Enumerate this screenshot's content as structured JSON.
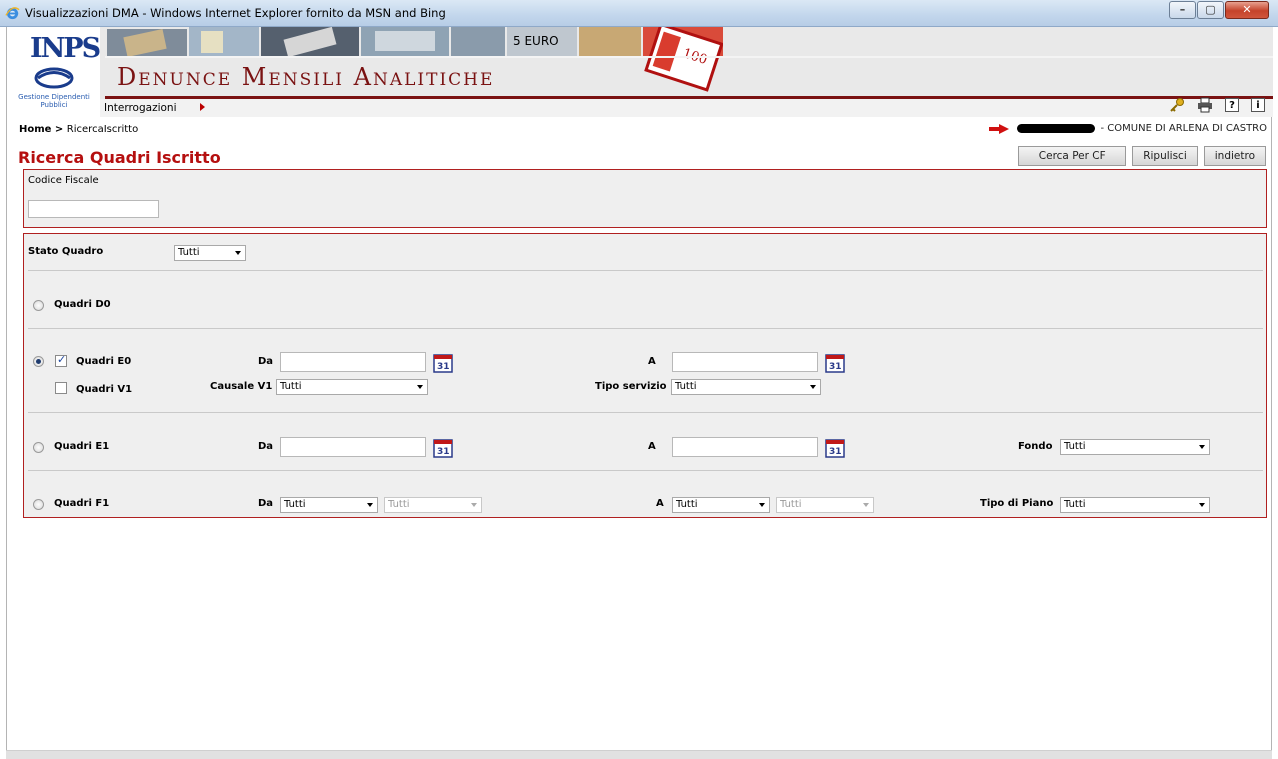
{
  "window": {
    "title": "Visualizzazioni DMA - Windows Internet Explorer fornito da MSN and Bing",
    "buttons": [
      "–",
      "▢",
      "✕"
    ]
  },
  "header": {
    "logo_text": "INPS",
    "logo_sub": "Gestione Dipendenti Pubblici",
    "banner_title": "Denunce Mensili Analitiche",
    "banner_photo_text_5euro": "5 EURO",
    "banner_photo_text_100": "100",
    "menu": {
      "label": "Interrogazioni"
    },
    "toolbar_icons": [
      "key-icon",
      "printer-icon",
      "help-icon",
      "info-icon"
    ],
    "help_label": "?",
    "info_label": "i"
  },
  "breadcrumb": {
    "home": "Home",
    "sep": " > ",
    "current": "RicercaIscritto"
  },
  "user": {
    "entity": "- COMUNE DI ARLENA DI CASTRO"
  },
  "page": {
    "title": "Ricerca Quadri Iscritto"
  },
  "actions": {
    "search_cf": "Cerca Per CF",
    "reset": "Ripulisci",
    "back": "indietro"
  },
  "search": {
    "codice_fiscale_label": "Codice Fiscale",
    "codice_fiscale_value": ""
  },
  "filters": {
    "stato_quadro_label": "Stato Quadro",
    "stato_quadro_value": "Tutti",
    "d0": {
      "label": "Quadri D0",
      "selected": false
    },
    "e0": {
      "label": "Quadri E0",
      "selected": true,
      "checked": true,
      "da_label": "Da",
      "a_label": "A",
      "da_value": "",
      "a_value": ""
    },
    "v1": {
      "label": "Quadri V1",
      "checked": false,
      "causale_label": "Causale V1",
      "causale_value": "Tutti",
      "tipo_servizio_label": "Tipo servizio",
      "tipo_servizio_value": "Tutti"
    },
    "e1": {
      "label": "Quadri E1",
      "selected": false,
      "da_label": "Da",
      "a_label": "A",
      "da_value": "",
      "a_value": "",
      "fondo_label": "Fondo",
      "fondo_value": "Tutti"
    },
    "f1": {
      "label": "Quadri F1",
      "selected": false,
      "da_label": "Da",
      "da_value1": "Tutti",
      "da_value2": "Tutti",
      "a_label": "A",
      "a_value1": "Tutti",
      "a_value2": "Tutti",
      "tipo_piano_label": "Tipo di Piano",
      "tipo_piano_value": "Tutti"
    },
    "calendar_day": "31"
  },
  "colors": {
    "accent": "#b50f0f",
    "panel_border": "#b02020",
    "banner": "#7a1212"
  }
}
